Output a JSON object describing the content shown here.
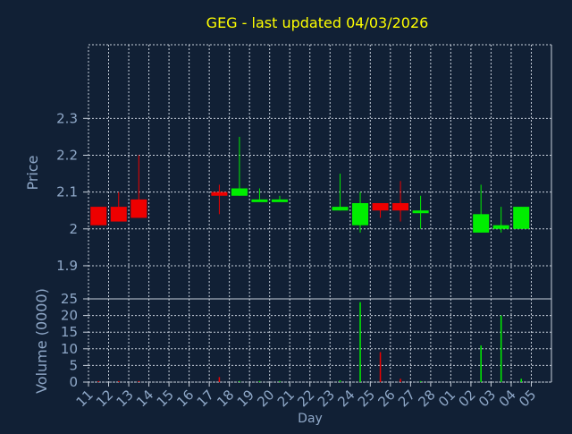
{
  "title": "GEG - last updated 04/03/2026",
  "colors": {
    "background": "#112035",
    "title": "#ffff00",
    "axis_text": "#8fa8c8",
    "grid": "#c8d0dc",
    "up": "#00ee00",
    "down": "#ee0000"
  },
  "chart_data": [
    {
      "type": "candlestick",
      "ylabel": "Price",
      "ylim": [
        1.81,
        2.5
      ],
      "yticks": [
        "1.9",
        "2",
        "2.1",
        "2.2",
        "2.3"
      ],
      "ytick_values": [
        1.9,
        2.0,
        2.1,
        2.2,
        2.3
      ],
      "grid": true,
      "categories": [
        "11",
        "12",
        "13",
        "14",
        "15",
        "16",
        "17",
        "18",
        "19",
        "20",
        "21",
        "22",
        "23",
        "24",
        "25",
        "26",
        "27",
        "28",
        "01",
        "02",
        "03",
        "04",
        "05"
      ],
      "candles": [
        {
          "day": "11",
          "open": 2.06,
          "high": 2.06,
          "low": 2.01,
          "close": 2.01
        },
        {
          "day": "12",
          "open": 2.06,
          "high": 2.1,
          "low": 2.02,
          "close": 2.02
        },
        {
          "day": "13",
          "open": 2.08,
          "high": 2.2,
          "low": 2.03,
          "close": 2.03
        },
        {
          "day": "17",
          "open": 2.1,
          "high": 2.12,
          "low": 2.04,
          "close": 2.09
        },
        {
          "day": "18",
          "open": 2.09,
          "high": 2.25,
          "low": 2.09,
          "close": 2.11
        },
        {
          "day": "19",
          "open": 2.08,
          "high": 2.11,
          "low": 2.08,
          "close": 2.08
        },
        {
          "day": "20",
          "open": 2.08,
          "high": 2.09,
          "low": 2.08,
          "close": 2.08
        },
        {
          "day": "23",
          "open": 2.05,
          "high": 2.15,
          "low": 2.05,
          "close": 2.06
        },
        {
          "day": "24",
          "open": 2.01,
          "high": 2.1,
          "low": 1.99,
          "close": 2.07
        },
        {
          "day": "25",
          "open": 2.07,
          "high": 2.07,
          "low": 2.03,
          "close": 2.05
        },
        {
          "day": "26",
          "open": 2.07,
          "high": 2.13,
          "low": 2.02,
          "close": 2.05
        },
        {
          "day": "27",
          "open": 2.05,
          "high": 2.09,
          "low": 2.0,
          "close": 2.05
        },
        {
          "day": "02",
          "open": 1.99,
          "high": 2.12,
          "low": 1.99,
          "close": 2.04
        },
        {
          "day": "03",
          "open": 2.0,
          "high": 2.06,
          "low": 1.99,
          "close": 2.01
        },
        {
          "day": "04",
          "open": 2.0,
          "high": 2.06,
          "low": 2.0,
          "close": 2.06
        }
      ]
    },
    {
      "type": "bar",
      "ylabel": "Volume (0000)",
      "xlabel": "Day",
      "ylim": [
        0,
        25
      ],
      "yticks": [
        "0",
        "5",
        "10",
        "15",
        "20",
        "25"
      ],
      "ytick_values": [
        0,
        5,
        10,
        15,
        20,
        25
      ],
      "grid": true,
      "categories": [
        "11",
        "12",
        "13",
        "14",
        "15",
        "16",
        "17",
        "18",
        "19",
        "20",
        "21",
        "22",
        "23",
        "24",
        "25",
        "26",
        "27",
        "28",
        "01",
        "02",
        "03",
        "04",
        "05"
      ],
      "bars": [
        {
          "day": "11",
          "value": 0.3,
          "direction": "down"
        },
        {
          "day": "12",
          "value": 0.3,
          "direction": "down"
        },
        {
          "day": "13",
          "value": 0.3,
          "direction": "down"
        },
        {
          "day": "17",
          "value": 1.5,
          "direction": "down"
        },
        {
          "day": "18",
          "value": 0.3,
          "direction": "up"
        },
        {
          "day": "19",
          "value": 0.3,
          "direction": "up"
        },
        {
          "day": "20",
          "value": 0.3,
          "direction": "up"
        },
        {
          "day": "23",
          "value": 0.5,
          "direction": "up"
        },
        {
          "day": "24",
          "value": 24,
          "direction": "up"
        },
        {
          "day": "25",
          "value": 9,
          "direction": "down"
        },
        {
          "day": "26",
          "value": 1,
          "direction": "down"
        },
        {
          "day": "27",
          "value": 0.3,
          "direction": "up"
        },
        {
          "day": "02",
          "value": 11,
          "direction": "up"
        },
        {
          "day": "03",
          "value": 20,
          "direction": "up"
        },
        {
          "day": "04",
          "value": 1,
          "direction": "up"
        }
      ]
    }
  ]
}
